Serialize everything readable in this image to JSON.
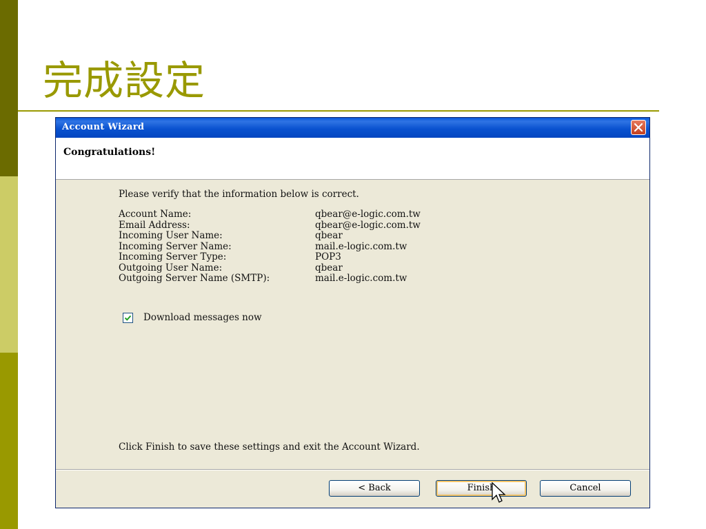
{
  "slide": {
    "title": "完成設定"
  },
  "dialog": {
    "window_title": "Account Wizard",
    "header_title": "Congratulations!",
    "intro": "Please verify that the information below is correct.",
    "info_rows": [
      {
        "label": "Account Name:",
        "value": "qbear@e-logic.com.tw"
      },
      {
        "label": "Email Address:",
        "value": "qbear@e-logic.com.tw"
      },
      {
        "label": "Incoming User Name:",
        "value": "qbear"
      },
      {
        "label": "Incoming Server Name:",
        "value": "mail.e-logic.com.tw"
      },
      {
        "label": "Incoming Server Type:",
        "value": "POP3"
      },
      {
        "label": "Outgoing User Name:",
        "value": "qbear"
      },
      {
        "label": "Outgoing Server Name (SMTP):",
        "value": "mail.e-logic.com.tw"
      }
    ],
    "download_checkbox": {
      "label": "Download messages now",
      "checked": true
    },
    "finish_note": "Click Finish to save these settings and exit the Account Wizard.",
    "buttons": {
      "back": "< Back",
      "finish": "Finish",
      "cancel": "Cancel"
    }
  },
  "colors": {
    "bar_top": "#6b6b00",
    "bar_mid": "#cccc66",
    "bar_bot": "#999900",
    "title": "#999900",
    "titlebar": "#0a52d0",
    "dialog_bg": "#ece9d8"
  },
  "icons": {
    "close": "close-icon",
    "check": "checkmark-icon",
    "cursor": "mouse-pointer-icon"
  }
}
